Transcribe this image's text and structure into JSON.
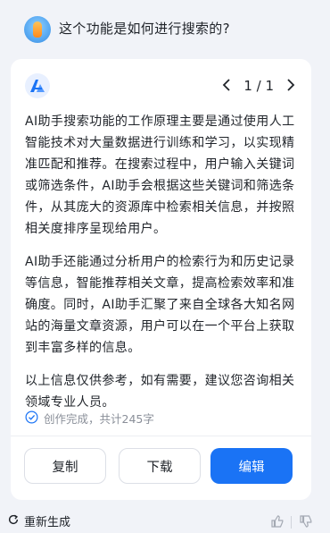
{
  "question": "这个功能是如何进行搜索的?",
  "pager": {
    "prev_icon": "chevron-left",
    "current": "1 / 1",
    "next_icon": "chevron-right"
  },
  "answer": {
    "paragraphs": [
      "AI助手搜索功能的工作原理主要是通过使用人工智能技术对大量数据进行训练和学习，以实现精准匹配和推荐。在搜索过程中，用户输入关键词或筛选条件，AI助手会根据这些关键词和筛选条件，从其庞大的资源库中检索相关信息，并按照相关度排序呈现给用户。",
      "AI助手还能通过分析用户的检索行为和历史记录等信息，智能推荐相关文章，提高检索效率和准确度。同时，AI助手汇聚了来自全球各大知名网站的海量文章资源，用户可以在一个平台上获取到丰富多样的信息。",
      "以上信息仅供参考，如有需要，建议您咨询相关领域专业人员。"
    ]
  },
  "status": {
    "text": "创作完成，共计245字",
    "icon": "check-circle-icon"
  },
  "actions": {
    "copy": "复制",
    "download": "下载",
    "edit": "编辑"
  },
  "footer": {
    "regenerate": "重新生成"
  },
  "colors": {
    "primary": "#1a73f5",
    "background": "#f1f3f8",
    "card": "#ffffff"
  }
}
